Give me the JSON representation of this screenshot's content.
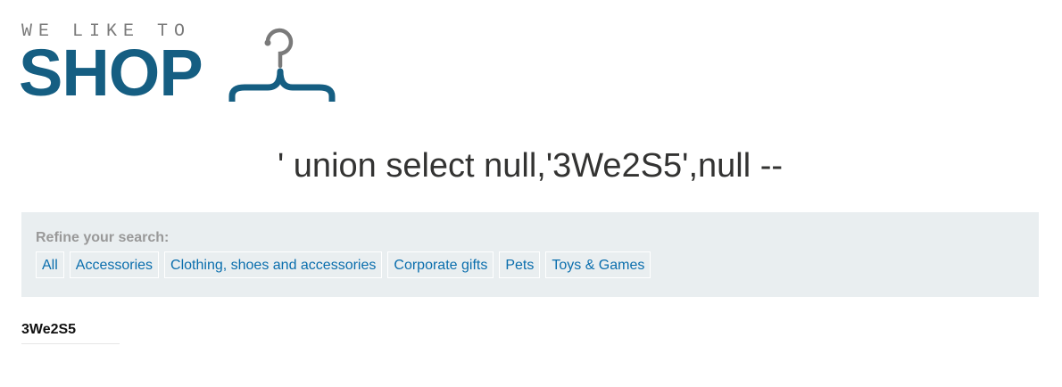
{
  "logo": {
    "tagline": "WE LIKE TO",
    "wordmark": "SHOP",
    "icon": "hanger-icon",
    "colors": {
      "wordmark": "#155e82",
      "tagline": "#7a7a7a",
      "hook": "#7a7a7a"
    }
  },
  "page": {
    "title": "' union select null,'3We2S5',null --"
  },
  "filters": {
    "label": "Refine your search:",
    "items": [
      {
        "label": "All"
      },
      {
        "label": "Accessories"
      },
      {
        "label": "Clothing, shoes and accessories"
      },
      {
        "label": "Corporate gifts"
      },
      {
        "label": "Pets"
      },
      {
        "label": "Toys & Games"
      }
    ],
    "colors": {
      "panel_background": "#e9eef0",
      "link": "#0a6ead"
    }
  },
  "results": [
    {
      "name": "3We2S5"
    }
  ]
}
